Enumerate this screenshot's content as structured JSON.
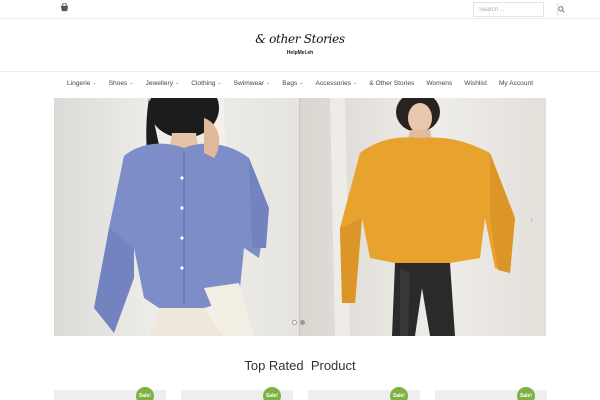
{
  "header": {
    "search_placeholder": "Search ...",
    "logo_text": "& other Stories",
    "logo_subtitle": "HelpMel.eh"
  },
  "nav": {
    "items": [
      {
        "label": "Lingerie",
        "dropdown": true
      },
      {
        "label": "Shoes",
        "dropdown": true
      },
      {
        "label": "Jewellery",
        "dropdown": true
      },
      {
        "label": "Clothing",
        "dropdown": true
      },
      {
        "label": "Swimwear",
        "dropdown": true
      },
      {
        "label": "Bags",
        "dropdown": true
      },
      {
        "label": "Accessories",
        "dropdown": true
      },
      {
        "label": "& Other Stories",
        "dropdown": false
      },
      {
        "label": "Womens",
        "dropdown": false
      },
      {
        "label": "Wishlist",
        "dropdown": false
      },
      {
        "label": "My Account",
        "dropdown": false
      }
    ],
    "chevron": "⌄"
  },
  "slider": {
    "next_arrow": "›",
    "active_slide": 2,
    "slide_count": 2
  },
  "section": {
    "title": "Top Rated  Product"
  },
  "products": [
    {
      "badge": "Sale!"
    },
    {
      "badge": "Sale!"
    },
    {
      "badge": "Sale!"
    },
    {
      "badge": "Sale!"
    }
  ],
  "colors": {
    "sale_badge": "#7cb342",
    "cardigan": "#7d8dc8",
    "sweater": "#e8a22e",
    "pants": "#2a2a2a"
  }
}
